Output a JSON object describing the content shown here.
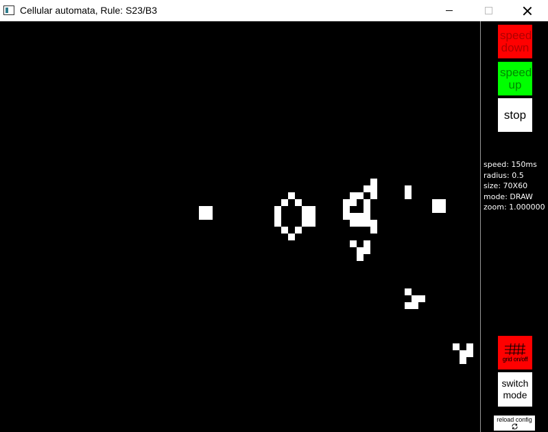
{
  "window": {
    "title": "Cellular automata, Rule: S23/B3"
  },
  "controls": {
    "speed_down_label": "speed down",
    "speed_up_label": "speed up",
    "stop_label": "stop",
    "grid_toggle_label": "grid on/off",
    "switch_mode_label": "switch mode",
    "reload_config_label": "reload config"
  },
  "stats": {
    "speed": "speed: 150ms",
    "radius": "radius: 0.5",
    "size": "size: 70X60",
    "mode": "mode: DRAW",
    "zoom": "zoom: 1.000000"
  },
  "colors": {
    "canvas_background": "#000000",
    "live_cell": "#ffffff",
    "speed_down_bg": "#ff0000",
    "speed_up_bg": "#00ff00",
    "grid_toggle_bg": "#ff0000"
  },
  "grid": {
    "cols": 70,
    "rows": 60,
    "live_cells": [
      [
        29,
        28
      ],
      [
        30,
        28
      ],
      [
        29,
        29
      ],
      [
        30,
        29
      ],
      [
        42,
        26
      ],
      [
        41,
        27
      ],
      [
        43,
        27
      ],
      [
        40,
        28
      ],
      [
        44,
        28
      ],
      [
        45,
        28
      ],
      [
        40,
        29
      ],
      [
        44,
        29
      ],
      [
        45,
        29
      ],
      [
        40,
        30
      ],
      [
        44,
        30
      ],
      [
        45,
        30
      ],
      [
        41,
        31
      ],
      [
        43,
        31
      ],
      [
        42,
        32
      ],
      [
        54,
        24
      ],
      [
        53,
        25
      ],
      [
        54,
        25
      ],
      [
        51,
        26
      ],
      [
        52,
        26
      ],
      [
        54,
        26
      ],
      [
        50,
        27
      ],
      [
        51,
        27
      ],
      [
        53,
        27
      ],
      [
        50,
        28
      ],
      [
        53,
        28
      ],
      [
        50,
        29
      ],
      [
        51,
        29
      ],
      [
        52,
        29
      ],
      [
        53,
        29
      ],
      [
        51,
        30
      ],
      [
        52,
        30
      ],
      [
        53,
        30
      ],
      [
        54,
        30
      ],
      [
        54,
        31
      ],
      [
        59,
        25
      ],
      [
        59,
        26
      ],
      [
        63,
        27
      ],
      [
        64,
        27
      ],
      [
        63,
        28
      ],
      [
        64,
        28
      ],
      [
        51,
        33
      ],
      [
        53,
        33
      ],
      [
        52,
        34
      ],
      [
        53,
        34
      ],
      [
        52,
        35
      ],
      [
        59,
        40
      ],
      [
        60,
        41
      ],
      [
        61,
        41
      ],
      [
        59,
        42
      ],
      [
        60,
        42
      ],
      [
        66,
        48
      ],
      [
        68,
        48
      ],
      [
        67,
        49
      ],
      [
        68,
        49
      ],
      [
        67,
        50
      ]
    ]
  }
}
